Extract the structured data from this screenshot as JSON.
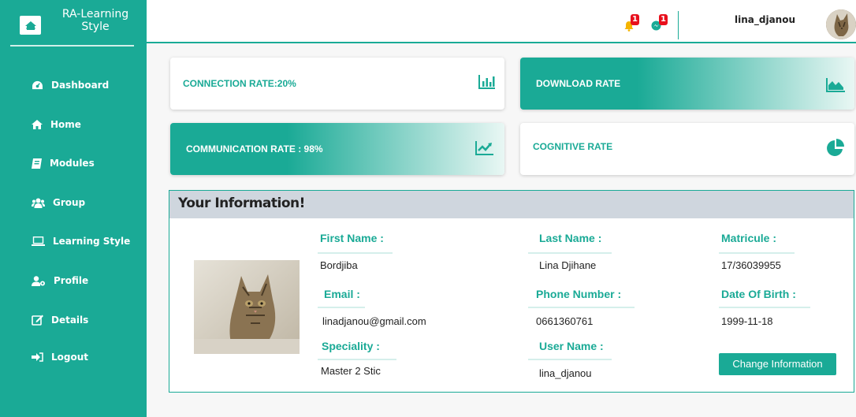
{
  "brand": {
    "title_line1": "RA-Learning",
    "title_line2": "Style"
  },
  "nav": {
    "items": [
      {
        "label": "Dashboard",
        "icon": "dashboard-icon"
      },
      {
        "label": "Home",
        "icon": "home-icon"
      },
      {
        "label": "Modules",
        "icon": "book-icon"
      },
      {
        "label": "Group",
        "icon": "users-icon"
      },
      {
        "label": "Learning Style",
        "icon": "laptop-icon"
      },
      {
        "label": "Profile",
        "icon": "user-cog-icon"
      },
      {
        "label": "Details",
        "icon": "edit-icon"
      },
      {
        "label": "Logout",
        "icon": "sign-out-icon"
      }
    ]
  },
  "topbar": {
    "notifications_count": "1",
    "messages_count": "1",
    "username": "lina_djanou"
  },
  "cards": [
    {
      "label": "CONNECTION RATE:20%",
      "icon": "bar-chart-icon"
    },
    {
      "label": "DOWNLOAD RATE",
      "icon": "area-chart-icon"
    },
    {
      "label": "COMMUNICATION RATE : 98%",
      "icon": "line-chart-icon"
    },
    {
      "label": "COGNITIVE RATE",
      "icon": "pie-chart-icon"
    }
  ],
  "info": {
    "title": "Your Information!",
    "fields": {
      "first_name": {
        "label": "First Name :",
        "value": "Bordjiba"
      },
      "last_name": {
        "label": "Last Name :",
        "value": "Lina Djihane"
      },
      "matricule": {
        "label": "Matricule :",
        "value": "17/36039955"
      },
      "email": {
        "label": "Email :",
        "value": "linadjanou@gmail.com"
      },
      "phone": {
        "label": "Phone Number :",
        "value": "0661360761"
      },
      "dob": {
        "label": "Date Of Birth :",
        "value": "1999-11-18"
      },
      "speciality": {
        "label": "Speciality :",
        "value": "Master 2 Stic"
      },
      "username": {
        "label": "User Name :",
        "value": "lina_djanou"
      }
    },
    "change_button": "Change Information"
  },
  "colors": {
    "accent": "#1aaa96",
    "badge": "#e8101c",
    "bell": "#f5b400",
    "messenger": "#1aaa96"
  }
}
